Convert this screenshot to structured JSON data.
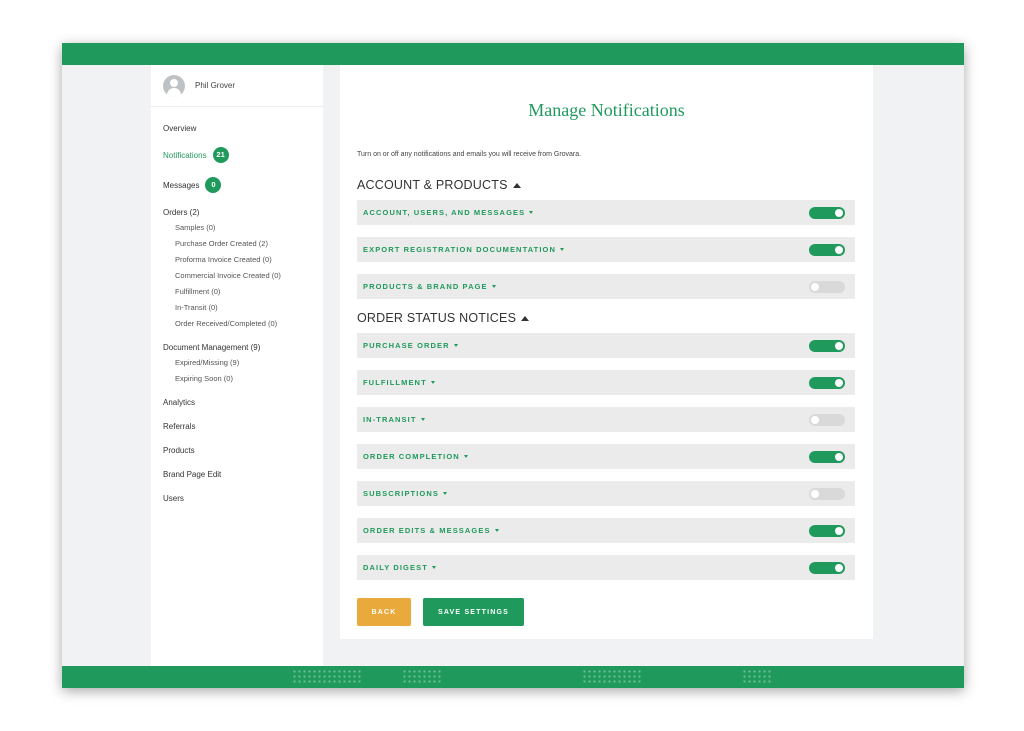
{
  "user": {
    "name": "Phil Grover"
  },
  "sidebar": {
    "overview": "Overview",
    "notifications": {
      "label": "Notifications",
      "count": "21"
    },
    "messages": {
      "label": "Messages",
      "count": "0"
    },
    "orders": {
      "label": "Orders (2)",
      "items": [
        "Samples (0)",
        "Purchase Order Created (2)",
        "Proforma Invoice Created (0)",
        "Commercial Invoice Created (0)",
        "Fulfillment (0)",
        "In-Transit (0)",
        "Order Received/Completed (0)"
      ]
    },
    "documents": {
      "label": "Document Management (9)",
      "items": [
        "Expired/Missing (9)",
        "Expiring Soon (0)"
      ]
    },
    "analytics": "Analytics",
    "referrals": "Referrals",
    "products": "Products",
    "brand_page_edit": "Brand Page Edit",
    "users": "Users"
  },
  "main": {
    "title": "Manage Notifications",
    "intro": "Turn on or off any notifications and emails you will receive from Grovara.",
    "sections": [
      {
        "title": "ACCOUNT & PRODUCTS",
        "rows": [
          {
            "label": "ACCOUNT, USERS, AND MESSAGES",
            "enabled": true
          },
          {
            "label": "EXPORT REGISTRATION DOCUMENTATION",
            "enabled": true
          },
          {
            "label": "PRODUCTS & BRAND PAGE",
            "enabled": false
          }
        ]
      },
      {
        "title": "ORDER STATUS NOTICES",
        "rows": [
          {
            "label": "PURCHASE ORDER",
            "enabled": true
          },
          {
            "label": "FULFILLMENT",
            "enabled": true
          },
          {
            "label": "IN-TRANSIT",
            "enabled": false
          },
          {
            "label": "ORDER COMPLETION",
            "enabled": true
          },
          {
            "label": "SUBSCRIPTIONS",
            "enabled": false
          },
          {
            "label": "ORDER EDITS & MESSAGES",
            "enabled": true
          },
          {
            "label": "DAILY DIGEST",
            "enabled": true
          }
        ]
      }
    ],
    "back_label": "BACK",
    "save_label": "SAVE SETTINGS"
  },
  "colors": {
    "brand_green": "#1f9a5c",
    "back_orange": "#e9a93b",
    "toggle_off": "#d9d9d9",
    "row_bg": "#ebebeb"
  }
}
